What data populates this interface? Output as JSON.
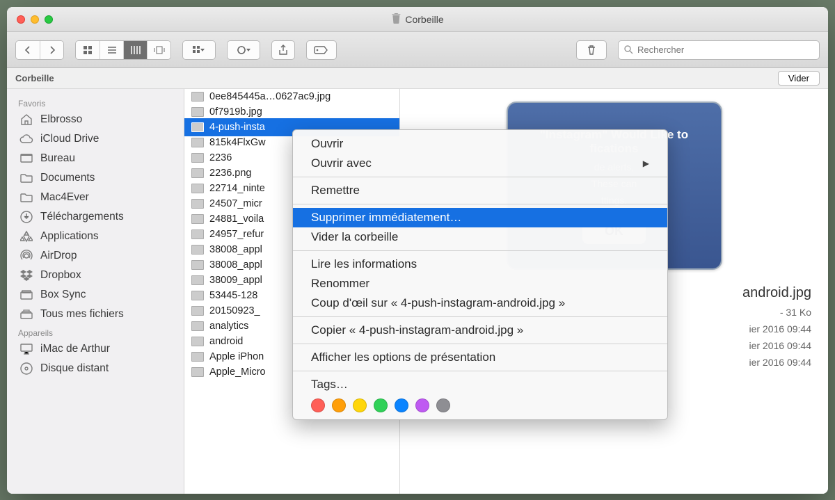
{
  "window": {
    "title": "Corbeille"
  },
  "toolbar": {
    "search_placeholder": "Rechercher"
  },
  "pathbar": {
    "location": "Corbeille",
    "empty_label": "Vider"
  },
  "sidebar": {
    "sections": [
      {
        "header": "Favoris",
        "items": [
          {
            "icon": "home",
            "label": "Elbrosso"
          },
          {
            "icon": "cloud",
            "label": "iCloud Drive"
          },
          {
            "icon": "desktop",
            "label": "Bureau"
          },
          {
            "icon": "folder",
            "label": "Documents"
          },
          {
            "icon": "folder",
            "label": "Mac4Ever"
          },
          {
            "icon": "download",
            "label": "Téléchargements"
          },
          {
            "icon": "apps",
            "label": "Applications"
          },
          {
            "icon": "airdrop",
            "label": "AirDrop"
          },
          {
            "icon": "dropbox",
            "label": "Dropbox"
          },
          {
            "icon": "box",
            "label": "Box Sync"
          },
          {
            "icon": "allfiles",
            "label": "Tous mes fichiers"
          }
        ]
      },
      {
        "header": "Appareils",
        "items": [
          {
            "icon": "imac",
            "label": "iMac de Arthur"
          },
          {
            "icon": "disc",
            "label": "Disque distant"
          }
        ]
      }
    ]
  },
  "files": [
    "0ee845445a…0627ac9.jpg",
    "0f7919b.jpg",
    "4-push-insta",
    "815k4FlxGw",
    "2236",
    "2236.png",
    "22714_ninte",
    "24507_micr",
    "24881_voila",
    "24957_refur",
    "38008_appl",
    "38008_appl",
    "38009_appl",
    "53445-128",
    "20150923_",
    "analytics",
    "android",
    "Apple iPhon",
    "Apple_Micro"
  ],
  "selected_index": 2,
  "preview": {
    "dialog_title": "\"Instagram\" Would Like to",
    "dialog_title2": "fications",
    "dialog_body1": "de alerts,",
    "dialog_body2": "These can",
    "dialog_body3": "ttings.",
    "ok": "OK",
    "filename": "android.jpg",
    "meta1": "- 31 Ko",
    "meta2": "ier 2016 09:44",
    "meta3": "ier 2016 09:44",
    "meta4": "ier 2016 09:44"
  },
  "context_menu": {
    "items": [
      {
        "label": "Ouvrir"
      },
      {
        "label": "Ouvrir avec",
        "submenu": true
      },
      {
        "sep": true
      },
      {
        "label": "Remettre"
      },
      {
        "sep": true
      },
      {
        "label": "Supprimer immédiatement…",
        "highlight": true
      },
      {
        "label": "Vider la corbeille"
      },
      {
        "sep": true
      },
      {
        "label": "Lire les informations"
      },
      {
        "label": "Renommer"
      },
      {
        "label": "Coup d'œil sur « 4-push-instagram-android.jpg »"
      },
      {
        "sep": true
      },
      {
        "label": "Copier « 4-push-instagram-android.jpg »"
      },
      {
        "sep": true
      },
      {
        "label": "Afficher les options de présentation"
      },
      {
        "sep": true
      },
      {
        "label": "Tags…"
      }
    ],
    "tag_colors": [
      "#ff5f57",
      "#ff9f0a",
      "#ffd60a",
      "#30d158",
      "#0a84ff",
      "#bf5af2",
      "#8e8e93"
    ]
  }
}
